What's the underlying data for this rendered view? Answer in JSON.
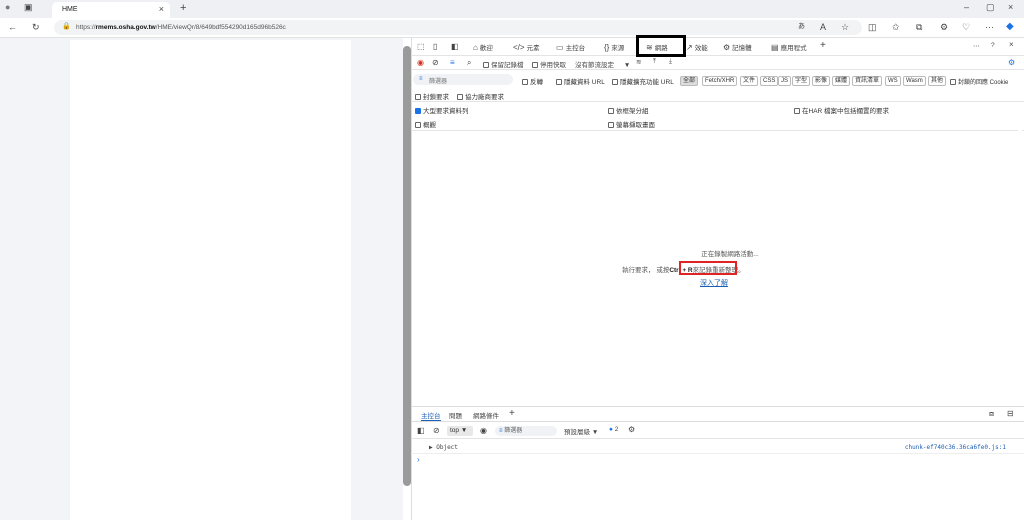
{
  "browser": {
    "tab_title": "HME",
    "url_host": "rmems.osha.gov.tw",
    "url_rest": "/HME/viewQr/8/649bdf554290d165d96b526c",
    "url_prefix": "https://"
  },
  "devtools": {
    "tabs": [
      {
        "label": "歡迎",
        "icon": "home-icon"
      },
      {
        "label": "元素",
        "icon": "code-icon"
      },
      {
        "label": "主控台",
        "icon": "console-icon"
      },
      {
        "label": "來源",
        "icon": "sources-icon"
      },
      {
        "label": "網路",
        "icon": "wifi-icon"
      },
      {
        "label": "效能",
        "icon": "performance-icon"
      },
      {
        "label": "記憶體",
        "icon": "memory-icon"
      },
      {
        "label": "應用程式",
        "icon": "application-icon"
      }
    ],
    "active_tab": "網路",
    "network_toolbar": {
      "preserve_log": "保留記錄檔",
      "disable_cache": "停用快取",
      "throttle": "沒有節流設定"
    },
    "filter": {
      "placeholder": "篩選器",
      "invert": "反轉",
      "hide_data_urls": "隱藏資料 URL",
      "hide_ext_urls": "隱藏擴充功能 URL",
      "types": [
        "全部",
        "Fetch/XHR",
        "文件",
        "CSS",
        "JS",
        "字型",
        "影像",
        "媒體",
        "資訊清單",
        "WS",
        "Wasm",
        "其他"
      ],
      "blocked_cookies": "封鎖的回應 Cookie",
      "blocked_requests": "封鎖要求",
      "third_party": "協力廠商要求"
    },
    "options": {
      "big_rows": "大型要求資料列",
      "group_by_frame": "依框架分組",
      "include_har": "在HAR 檔案中包括擱置的要求",
      "overview": "概觀",
      "capture_screenshots": "螢幕擷取畫面"
    },
    "empty_state": {
      "line1": "正在錄製網路活動...",
      "line2_prefix": "執行要求，",
      "line2_key_pre": "或按",
      "line2_key": "Ctrl + R",
      "line2_key_post": "來",
      "line2_suffix": "記錄重新整理。",
      "learn_more": "深入了解"
    },
    "drawer": {
      "tabs": [
        "主控台",
        "問題",
        "網路條件"
      ],
      "context": "top",
      "filter_placeholder": "篩選器",
      "levels": "預設層級",
      "issues_count": "2",
      "log_entry": "Object",
      "log_source": "chunk-ef740c36.36ca6fe0.js:1"
    }
  }
}
